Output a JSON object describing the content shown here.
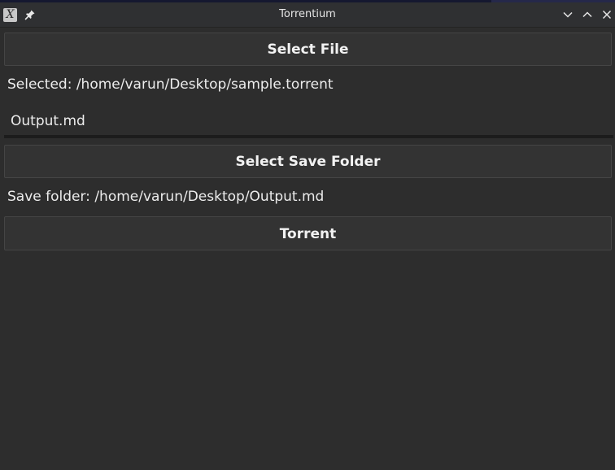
{
  "window": {
    "title": "Torrentium"
  },
  "titlebar": {
    "app_icon": "x11-app-icon",
    "app_icon_glyph": "X",
    "pin_icon": "pin-icon",
    "minimize_icon": "chevron-down-icon",
    "maximize_icon": "chevron-up-icon",
    "close_icon": "close-icon"
  },
  "main": {
    "select_file_label": "Select File",
    "selected_text": "Selected: /home/varun/Desktop/sample.torrent",
    "output_input_value": "Output.md",
    "select_save_folder_label": "Select Save Folder",
    "save_folder_text": "Save folder: /home/varun/Desktop/Output.md",
    "torrent_label": "Torrent"
  },
  "colors": {
    "background": "#2d2d2d",
    "titlebar": "#2f3032",
    "button": "#333333",
    "button_border": "#454545",
    "text": "#ececec"
  }
}
